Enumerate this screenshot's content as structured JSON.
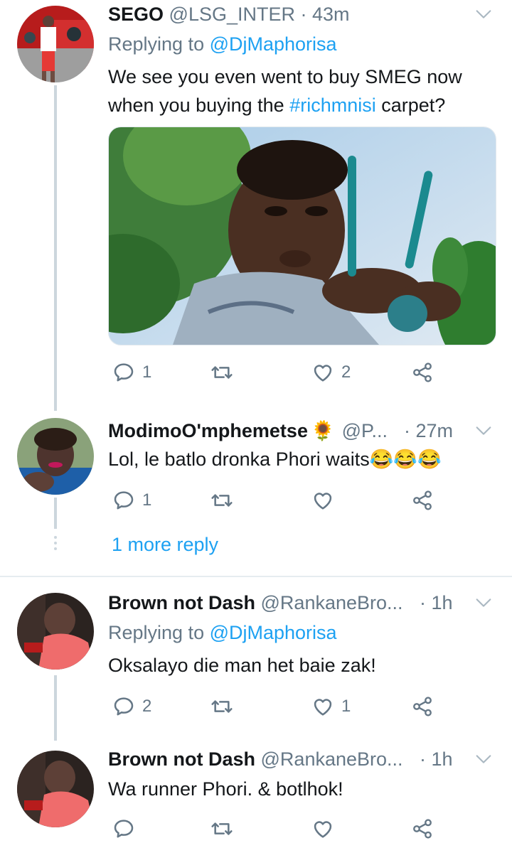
{
  "tweets": [
    {
      "name": "SEGO",
      "handle": "@LSG_INTER",
      "sep": " · ",
      "time": "43m",
      "replying_prefix": "Replying to ",
      "replying_mention": "@DjMaphorisa",
      "text_line1": "We see you even went to buy SMEG now",
      "text_line2_pre": "when you buying the ",
      "text_line2_tag": "#richmnisi",
      "text_line2_post": " carpet?",
      "reply_count": "1",
      "retweet_count": "",
      "like_count": "2"
    },
    {
      "name": "ModimoO'mphemetse",
      "emoji": "🌻",
      "handle": "@P...",
      "sep": " · ",
      "time": "27m",
      "text": "Lol, le batlo dronka Phori waits😂😂😂",
      "reply_count": "1",
      "retweet_count": "",
      "like_count": ""
    },
    {
      "name": "Brown not Dash",
      "handle": "@RankaneBro...",
      "sep": " · ",
      "time": "1h",
      "replying_prefix": "Replying to ",
      "replying_mention": "@DjMaphorisa",
      "text": "Oksalayo die man het baie zak!",
      "reply_count": "2",
      "retweet_count": "",
      "like_count": "1"
    },
    {
      "name": "Brown not Dash",
      "handle": "@RankaneBro...",
      "sep": " · ",
      "time": "1h",
      "text": "Wa runner Phori. & botlhok!",
      "reply_count": "",
      "retweet_count": "",
      "like_count": ""
    }
  ],
  "more_replies": "1 more reply",
  "colors": {
    "accent": "#1da1f2",
    "secondary_text": "#657786",
    "thread_line": "#ccd6dd"
  },
  "icons": [
    "reply-icon",
    "retweet-icon",
    "like-icon",
    "share-icon",
    "chevron-down-icon"
  ]
}
